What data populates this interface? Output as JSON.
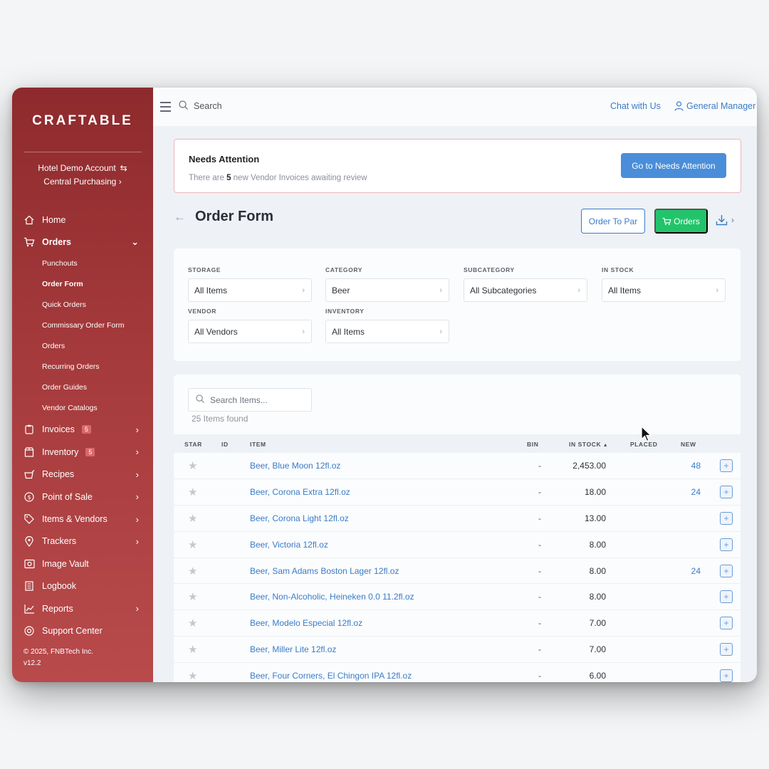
{
  "sidebar": {
    "logo": "CRAFTABLE",
    "account_line1": "Hotel Demo Account",
    "account_line2": "Central Purchasing",
    "nav": [
      {
        "label": "Home",
        "icon": "home-icon"
      },
      {
        "label": "Orders",
        "icon": "cart-icon",
        "expanded": true
      },
      {
        "label": "Invoices",
        "icon": "clipboard-icon",
        "badge": "5"
      },
      {
        "label": "Inventory",
        "icon": "box-icon",
        "badge": "5"
      },
      {
        "label": "Recipes",
        "icon": "pot-icon"
      },
      {
        "label": "Point of Sale",
        "icon": "dollar-circle-icon"
      },
      {
        "label": "Items & Vendors",
        "icon": "tag-icon"
      },
      {
        "label": "Trackers",
        "icon": "map-pin-icon"
      },
      {
        "label": "Image Vault",
        "icon": "image-vault-icon"
      },
      {
        "label": "Logbook",
        "icon": "book-icon"
      },
      {
        "label": "Reports",
        "icon": "chart-icon"
      },
      {
        "label": "Support Center",
        "icon": "lifebuoy-icon"
      }
    ],
    "orders_sub": [
      "Punchouts",
      "Order Form",
      "Quick Orders",
      "Commissary Order Form",
      "Orders",
      "Recurring Orders",
      "Order Guides",
      "Vendor Catalogs"
    ],
    "copyright": "© 2025, FNBTech Inc.",
    "version": "v12.2"
  },
  "topbar": {
    "search_placeholder": "Search",
    "chat": "Chat with Us",
    "user": "General Manager"
  },
  "attention": {
    "title": "Needs Attention",
    "text_prefix": "There are ",
    "count": "5",
    "text_suffix": " new Vendor Invoices awaiting review",
    "button": "Go to Needs Attention"
  },
  "page": {
    "title": "Order Form",
    "order_to_par": "Order To Par",
    "orders_button": "Orders"
  },
  "filters": {
    "storage_label": "STORAGE",
    "storage_value": "All Items",
    "category_label": "CATEGORY",
    "category_value": "Beer",
    "subcategory_label": "SUBCATEGORY",
    "subcategory_value": "All Subcategories",
    "instock_label": "IN STOCK",
    "instock_value": "All Items",
    "vendor_label": "VENDOR",
    "vendor_value": "All Vendors",
    "inventory_label": "INVENTORY",
    "inventory_value": "All Items"
  },
  "items": {
    "search_placeholder": "Search Items...",
    "found": "25 Items found",
    "columns": {
      "star": "STAR",
      "id": "ID",
      "item": "ITEM",
      "bin": "BIN",
      "in_stock": "IN STOCK",
      "placed": "PLACED",
      "new": "NEW"
    },
    "rows": [
      {
        "name": "Beer, Blue Moon 12fl.oz",
        "bin": "-",
        "stock": "2,453.00",
        "new": "48"
      },
      {
        "name": "Beer, Corona Extra 12fl.oz",
        "bin": "-",
        "stock": "18.00",
        "new": "24"
      },
      {
        "name": "Beer, Corona Light 12fl.oz",
        "bin": "-",
        "stock": "13.00",
        "new": ""
      },
      {
        "name": "Beer, Victoria 12fl.oz",
        "bin": "-",
        "stock": "8.00",
        "new": ""
      },
      {
        "name": "Beer, Sam Adams Boston Lager 12fl.oz",
        "bin": "-",
        "stock": "8.00",
        "new": "24"
      },
      {
        "name": "Beer, Non-Alcoholic, Heineken 0.0 11.2fl.oz",
        "bin": "-",
        "stock": "8.00",
        "new": ""
      },
      {
        "name": "Beer, Modelo Especial 12fl.oz",
        "bin": "-",
        "stock": "7.00",
        "new": ""
      },
      {
        "name": "Beer, Miller Lite 12fl.oz",
        "bin": "-",
        "stock": "7.00",
        "new": ""
      },
      {
        "name": "Beer, Four Corners, El Chingon IPA 12fl.oz",
        "bin": "-",
        "stock": "6.00",
        "new": ""
      }
    ]
  },
  "colors": {
    "brand": "#a53a3c",
    "link": "#3a7cc8",
    "primary_button": "#4a8ed9",
    "success_button": "#22c46b"
  }
}
